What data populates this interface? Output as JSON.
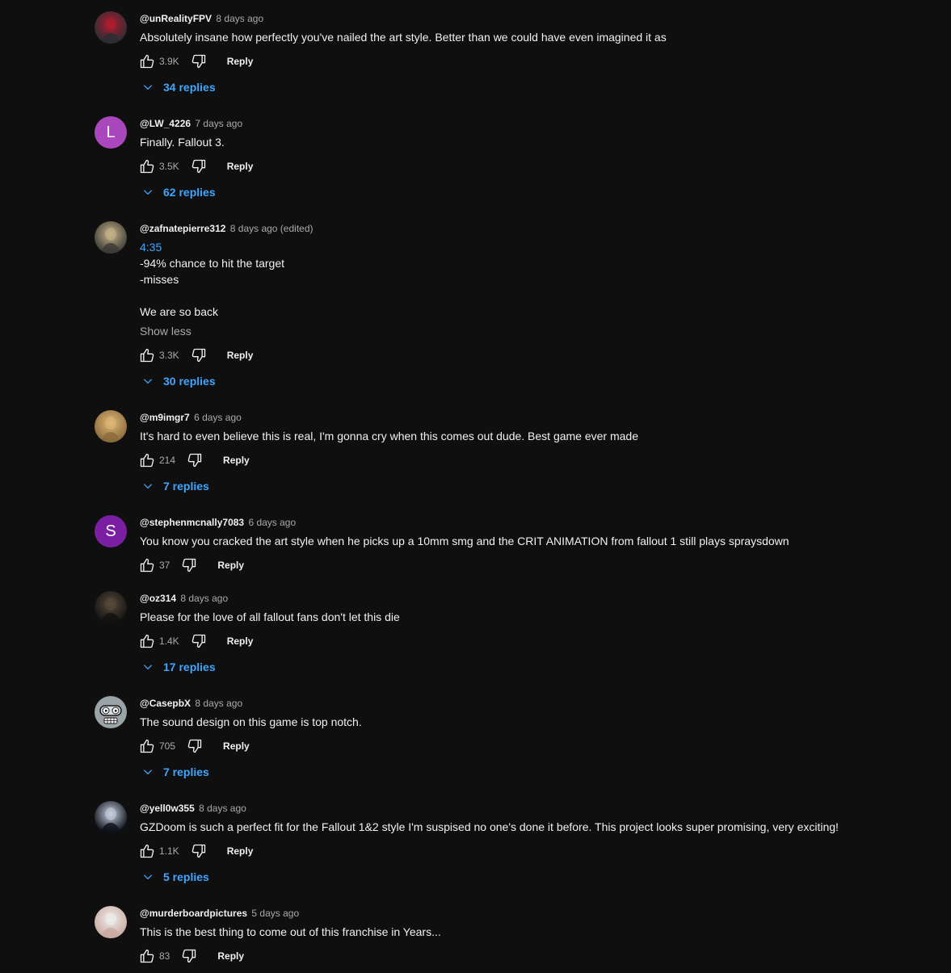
{
  "comments": [
    {
      "author": "@unRealityFPV",
      "time": "8 days ago",
      "text_lines": [
        "Absolutely insane how perfectly you've nailed the art style.  Better than we could have even imagined it as"
      ],
      "likes": "3.9K",
      "reply_label": "Reply",
      "replies": "34 replies",
      "avatar_colors": [
        "#2a2d33",
        "#b01c2e"
      ]
    },
    {
      "author": "@LW_4226",
      "time": "7 days ago",
      "text_lines": [
        "Finally. Fallout 3."
      ],
      "likes": "3.5K",
      "reply_label": "Reply",
      "replies": "62 replies",
      "avatar_letter": "L",
      "avatar_colors": [
        "#ab47bc"
      ]
    },
    {
      "author": "@zafnatepierre312",
      "time": "8 days ago (edited)",
      "timestamp_link": "4:35",
      "text_lines": [
        "-94% chance to hit the target",
        "-misses",
        "",
        "We are so back"
      ],
      "show_less": "Show less",
      "likes": "3.3K",
      "reply_label": "Reply",
      "replies": "30 replies",
      "avatar_colors": [
        "#3b3a35",
        "#c9b48a"
      ]
    },
    {
      "author": "@m9imgr7",
      "time": "6 days ago",
      "text_lines": [
        "It's hard to even believe this is real, I'm gonna cry when this comes out dude. Best game ever made"
      ],
      "likes": "214",
      "reply_label": "Reply",
      "replies": "7 replies",
      "avatar_colors": [
        "#8a6a3c",
        "#e0b876"
      ]
    },
    {
      "author": "@stephenmcnally7083",
      "time": "6 days ago",
      "text_lines": [
        "You know you cracked the art style when he picks up a 10mm smg and the CRIT ANIMATION from fallout 1 still plays spraysdown"
      ],
      "likes": "37",
      "reply_label": "Reply",
      "avatar_letter": "S",
      "avatar_colors": [
        "#7b1fa2"
      ]
    },
    {
      "author": "@oz314",
      "time": "8 days ago",
      "text_lines": [
        "Please for the love of all fallout fans don't let this die"
      ],
      "likes": "1.4K",
      "reply_label": "Reply",
      "replies": "17 replies",
      "avatar_colors": [
        "#121212",
        "#5a4a3a"
      ]
    },
    {
      "author": "@CasepbX",
      "time": "8 days ago",
      "text_lines": [
        "The sound design on this game is top notch."
      ],
      "likes": "705",
      "reply_label": "Reply",
      "replies": "7 replies",
      "avatar_colors": [
        "#9aa3a8",
        "#1a1a1a"
      ]
    },
    {
      "author": "@yell0w355",
      "time": "8 days ago",
      "text_lines": [
        "GZDoom is such a perfect fit for the Fallout 1&2 style I'm suspised no one's done it before. This project looks super promising, very exciting!"
      ],
      "likes": "1.1K",
      "reply_label": "Reply",
      "replies": "5 replies",
      "avatar_colors": [
        "#0b0f18",
        "#c7d2e0"
      ]
    },
    {
      "author": "@murderboardpictures",
      "time": "5 days ago",
      "text_lines": [
        "This is the best thing to come out of this franchise in Years..."
      ],
      "likes": "83",
      "reply_label": "Reply",
      "avatar_colors": [
        "#c9a9a0",
        "#eeeeee"
      ]
    }
  ],
  "colors": {
    "background": "#0f0f0f",
    "text": "#f1f1f1",
    "secondary_text": "#aaaaaa",
    "link": "#3ea6ff"
  }
}
